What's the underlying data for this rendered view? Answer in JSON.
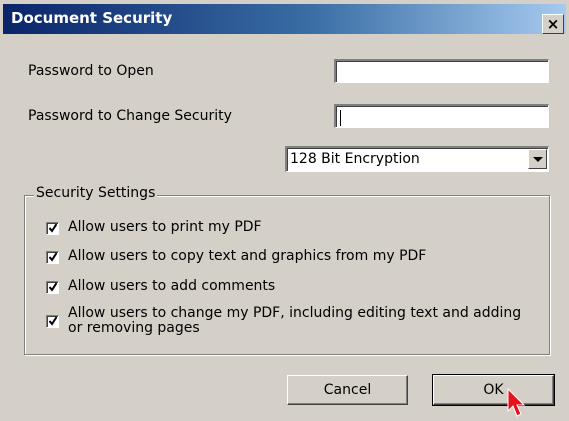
{
  "window": {
    "title": "Document Security",
    "close_label": "×"
  },
  "fields": {
    "password_open_label": "Password to Open",
    "password_open_value": "",
    "password_change_label": "Password to Change Security",
    "password_change_value": ""
  },
  "encryption": {
    "selected": "128 Bit Encryption"
  },
  "security_settings": {
    "legend": "Security Settings",
    "items": [
      {
        "label": "Allow users to print my PDF",
        "checked": true
      },
      {
        "label": "Allow users to copy text and graphics from my PDF",
        "checked": true
      },
      {
        "label": "Allow users to add comments",
        "checked": true
      },
      {
        "label": "Allow users to change my PDF, including editing text and adding or removing pages",
        "checked": true
      }
    ]
  },
  "buttons": {
    "cancel": "Cancel",
    "ok": "OK"
  },
  "colors": {
    "titlebar_start": "#0a246a",
    "titlebar_end": "#a6caf0",
    "dialog_bg": "#d4d0c8",
    "cursor": "#e8101a"
  },
  "icons": {
    "close": "close-icon",
    "dropdown": "chevron-down-icon",
    "check": "check-icon",
    "pointer": "mouse-pointer-icon"
  }
}
